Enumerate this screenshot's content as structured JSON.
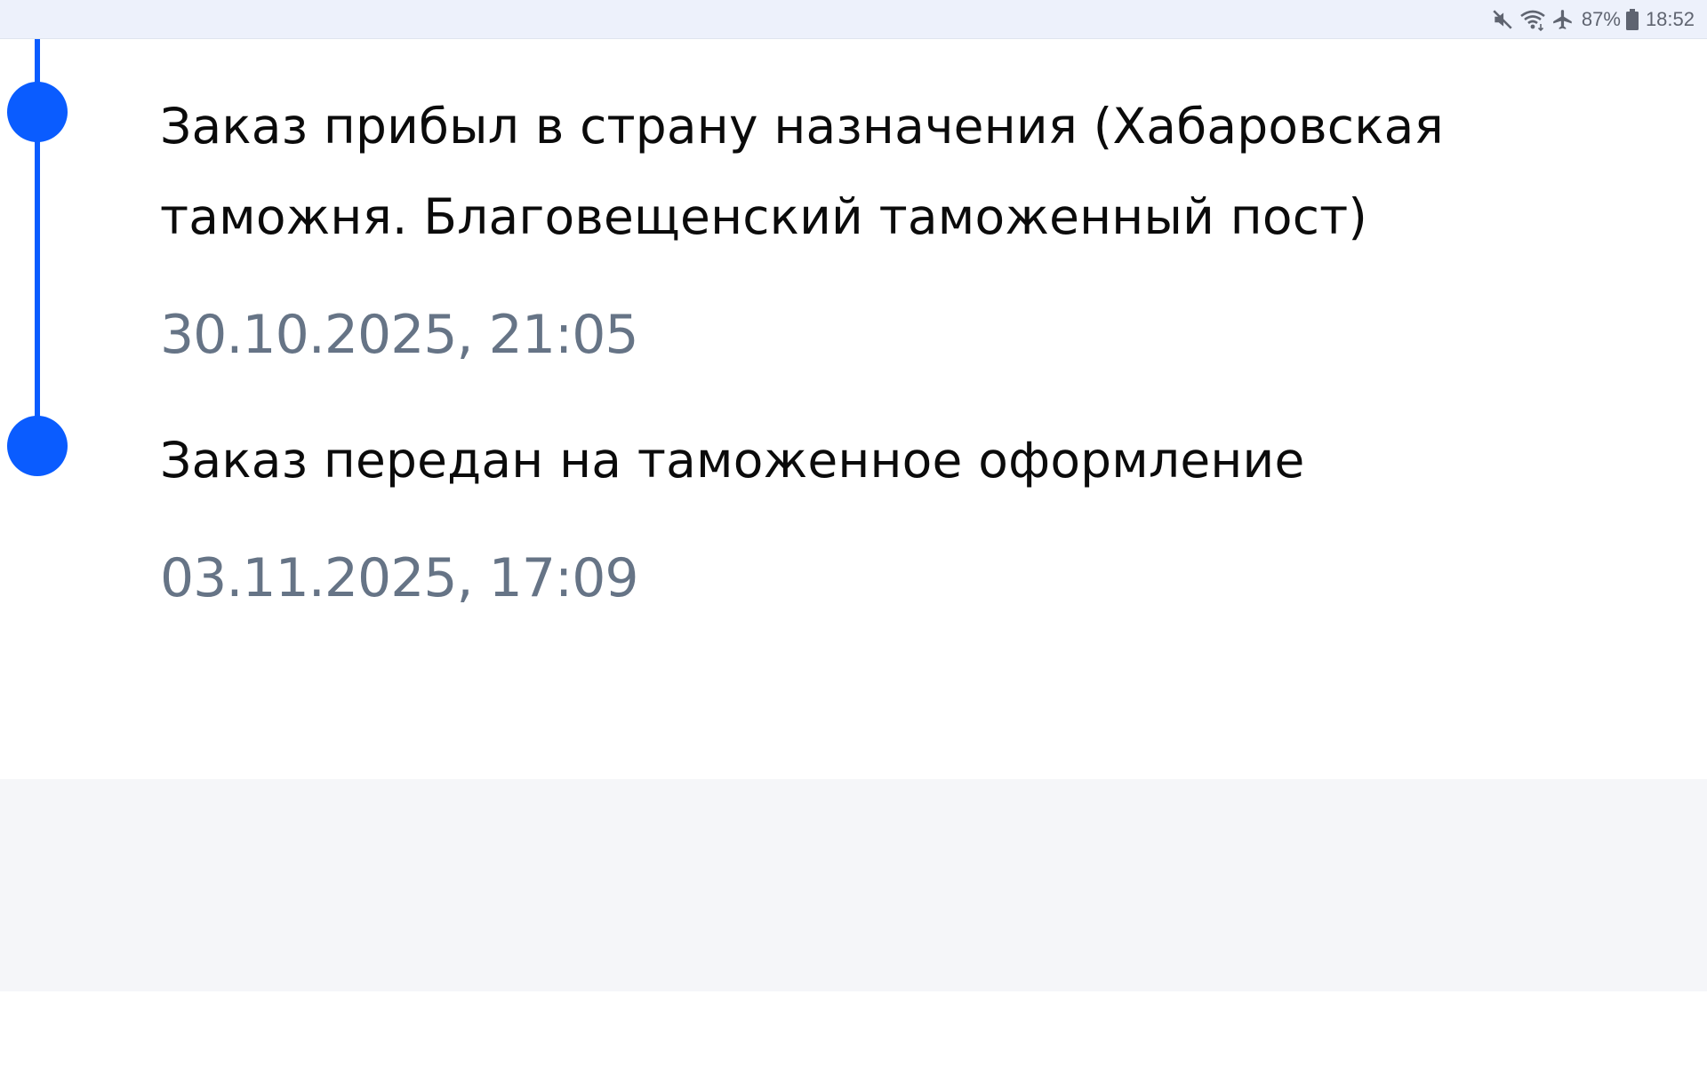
{
  "status_bar": {
    "icons": [
      "mute-icon",
      "wifi-icon",
      "airplane-mode-icon",
      "battery-icon"
    ],
    "battery_percent": "87%",
    "time": "18:52"
  },
  "timeline": {
    "accent_color": "#0a5cff",
    "events": [
      {
        "title": "Заказ прибыл в страну назначения (Хабаровская таможня. Благовещенский таможенный пост)",
        "datetime": "30.10.2025, 21:05"
      },
      {
        "title": "Заказ передан на таможенное оформление",
        "datetime": "03.11.2025, 17:09"
      }
    ]
  }
}
